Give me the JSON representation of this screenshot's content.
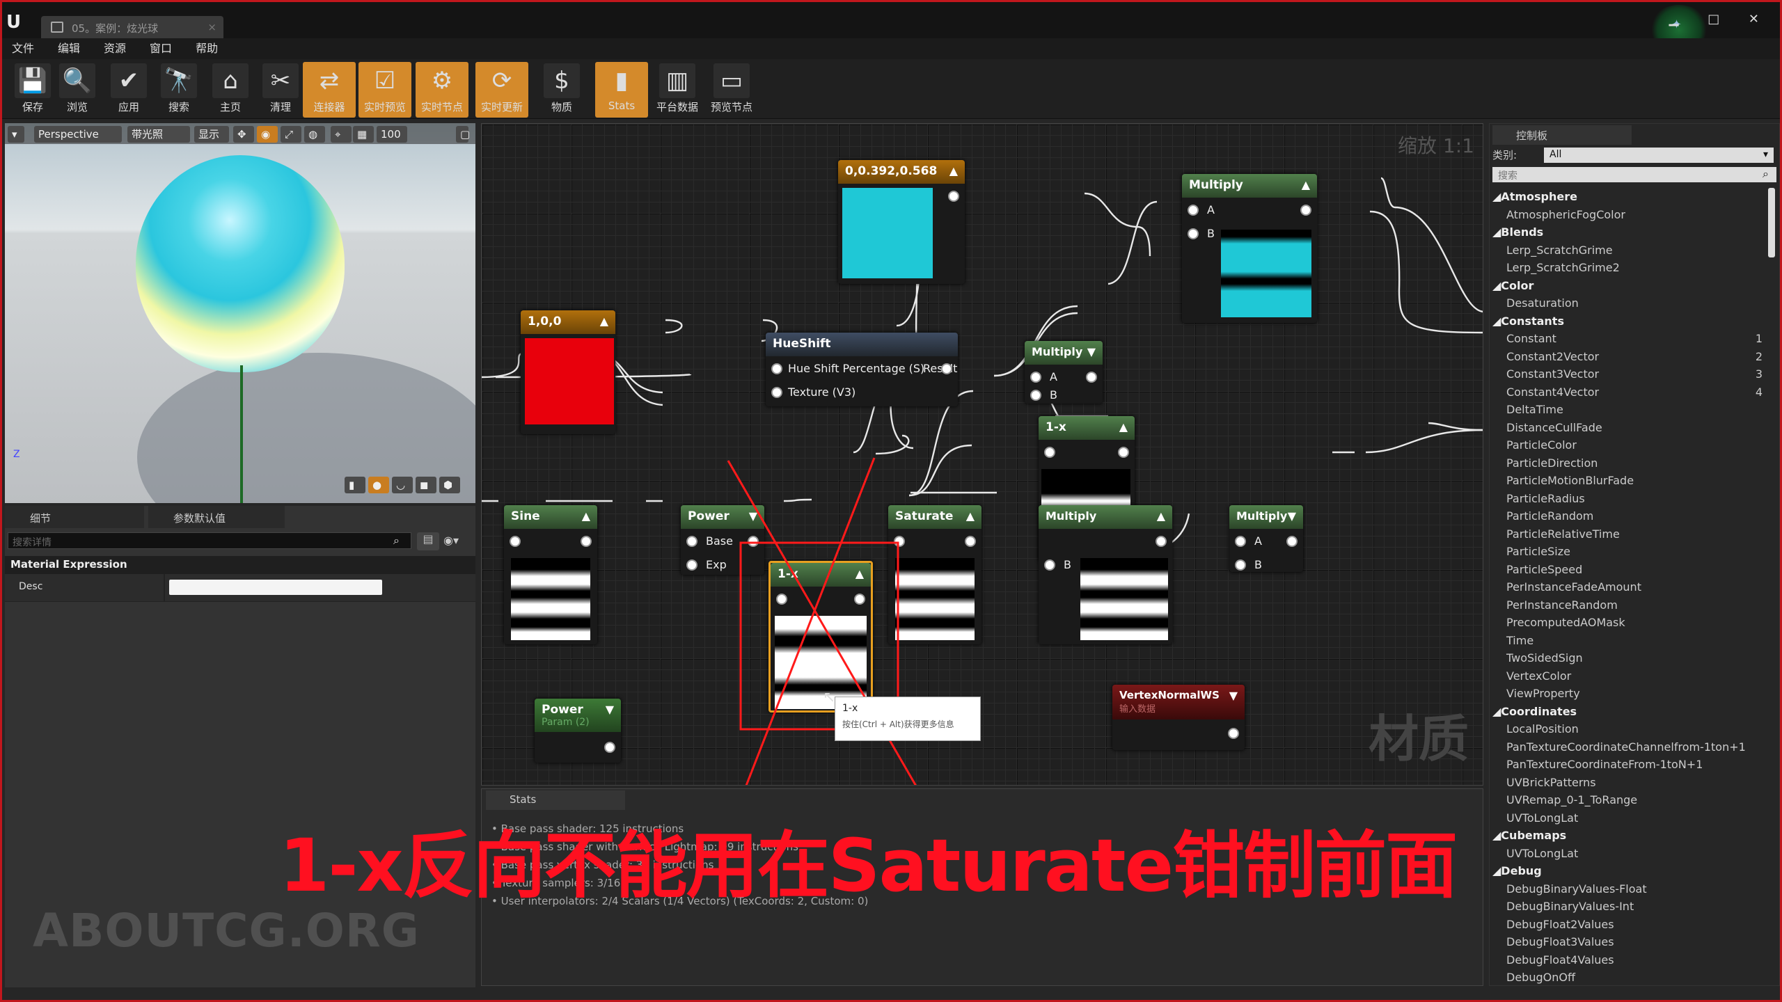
{
  "window": {
    "tab_title": "05。案例：炫光球",
    "tab_close": "×",
    "logo": "U",
    "controls": "▁ □ ✕"
  },
  "menu": [
    "文件",
    "编辑",
    "资源",
    "窗口",
    "帮助"
  ],
  "toolbar": [
    {
      "label": "保存",
      "icon": "save-icon",
      "glyph": "💾"
    },
    {
      "label": "浏览",
      "icon": "search-icon",
      "glyph": "🔍"
    },
    {
      "label": "应用",
      "icon": "apply-check-icon",
      "glyph": "✔"
    },
    {
      "label": "搜索",
      "icon": "binoculars-icon",
      "glyph": "🔭"
    },
    {
      "label": "主页",
      "icon": "home-icon",
      "glyph": "⌂"
    },
    {
      "label": "清理",
      "icon": "broom-icon",
      "glyph": "✂"
    },
    {
      "label": "连接器",
      "icon": "connector-icon",
      "glyph": "⇄",
      "active": true
    },
    {
      "label": "实时预览",
      "icon": "live-preview-icon",
      "glyph": "☑",
      "active": true
    },
    {
      "label": "实时节点",
      "icon": "live-nodes-icon",
      "glyph": "⚙",
      "active": true
    },
    {
      "label": "实时更新",
      "icon": "live-update-icon",
      "glyph": "⟳",
      "active": true
    },
    {
      "label": "物质",
      "icon": "material-icon",
      "glyph": "$"
    },
    {
      "label": "Stats",
      "icon": "stats-icon",
      "glyph": "▮",
      "active": true
    },
    {
      "label": "平台数据",
      "icon": "platform-stats-icon",
      "glyph": "▥"
    },
    {
      "label": "预览节点",
      "icon": "preview-node-icon",
      "glyph": "▭"
    }
  ],
  "viewport": {
    "view_mode": "Perspective",
    "lighting": "带光照",
    "show": "显示",
    "fov": "100",
    "axis_z": "Z"
  },
  "details": {
    "tab_details": "细节",
    "tab_params": "参数默认值",
    "search_placeholder": "搜索详情",
    "section": "Material Expression",
    "desc_label": "Desc",
    "desc_value": ""
  },
  "watermark": "ABOUTCG.ORG",
  "graph": {
    "zoom": "缩放 1:1",
    "watermark": "材质",
    "nodes": {
      "const_red": {
        "title": "1,0,0",
        "color": "#e8000c"
      },
      "const_cyan": {
        "title": "0,0.392,0.568",
        "color": "#1fc8d6"
      },
      "hueshift": {
        "title": "HueShift",
        "pin1": "Hue Shift Percentage (S)",
        "out": "Result",
        "pin2": "Texture (V3)"
      },
      "multiply_top": {
        "title": "Multiply",
        "a": "A",
        "b": "B"
      },
      "multiply_mid": {
        "title": "Multiply",
        "a": "A",
        "b": "B"
      },
      "oneminus_top": {
        "title": "1-x"
      },
      "sine": {
        "title": "Sine"
      },
      "power": {
        "title": "Power",
        "base": "Base",
        "exp": "Exp"
      },
      "oneminus_sel": {
        "title": "1-x"
      },
      "saturate": {
        "title": "Saturate"
      },
      "multiply_center": {
        "title": "Multiply",
        "b": "B"
      },
      "multiply_right": {
        "title": "Multiply",
        "a": "A",
        "b": "B"
      },
      "param_power": {
        "title": "Power",
        "subtitle": "Param (2)"
      },
      "vertexnormal": {
        "title": "VertexNormalWS",
        "subtitle": "输入数据"
      }
    },
    "tooltip": {
      "title": "1-x",
      "hint": "按住(Ctrl + Alt)获得更多信息"
    }
  },
  "stats": {
    "tab": "Stats",
    "lines": [
      "Base pass shader: 125 instructions",
      "Base pass shader with Surface Lightmap: 99 instructions",
      "Base pass vertex shader: 35 instructions",
      "Texture samplers: 3/16",
      "User interpolators: 2/4 Scalars (1/4 Vectors) (TexCoords: 2, Custom: 0)"
    ]
  },
  "palette": {
    "tab": "控制板",
    "category_label": "类别:",
    "category_value": "All",
    "search_placeholder": "搜索",
    "groups": [
      {
        "name": "Atmosphere",
        "items": [
          "AtmosphericFogColor"
        ]
      },
      {
        "name": "Blends",
        "items": [
          "Lerp_ScratchGrime",
          "Lerp_ScratchGrime2"
        ]
      },
      {
        "name": "Color",
        "items": [
          "Desaturation"
        ]
      },
      {
        "name": "Constants",
        "items": [
          "Constant|1",
          "Constant2Vector|2",
          "Constant3Vector|3",
          "Constant4Vector|4",
          "DeltaTime",
          "DistanceCullFade",
          "ParticleColor",
          "ParticleDirection",
          "ParticleMotionBlurFade",
          "ParticleRadius",
          "ParticleRandom",
          "ParticleRelativeTime",
          "ParticleSize",
          "ParticleSpeed",
          "PerInstanceFadeAmount",
          "PerInstanceRandom",
          "PrecomputedAOMask",
          "Time",
          "TwoSidedSign",
          "VertexColor",
          "ViewProperty"
        ]
      },
      {
        "name": "Coordinates",
        "items": [
          "LocalPosition",
          "PanTextureCoordinateChannelfrom-1ton+1",
          "PanTextureCoordinateFrom-1toN+1",
          "UVBrickPatterns",
          "UVRemap_0-1_ToRange",
          "UVToLongLat"
        ]
      },
      {
        "name": "Cubemaps",
        "items": [
          "UVToLongLat"
        ]
      },
      {
        "name": "Debug",
        "items": [
          "DebugBinaryValues-Float",
          "DebugBinaryValues-Int",
          "DebugFloat2Values",
          "DebugFloat3Values",
          "DebugFloat4Values",
          "DebugOnOff"
        ]
      }
    ]
  },
  "annotation": {
    "text": "1-x反向不能用在Saturate钳制前面",
    "color": "#ff1020"
  }
}
